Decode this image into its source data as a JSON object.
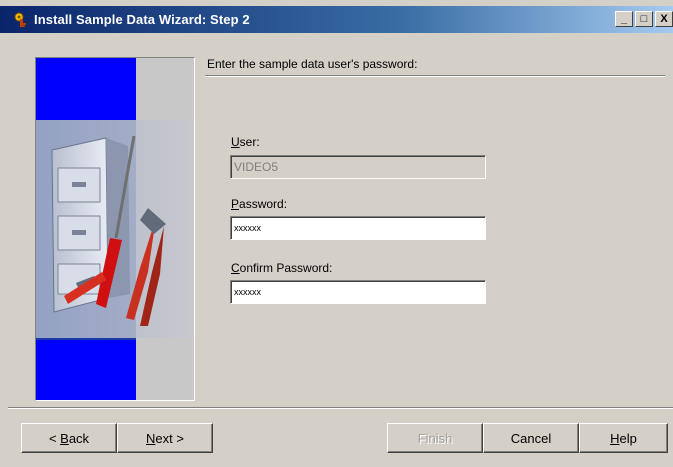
{
  "window": {
    "title": "Install Sample Data Wizard: Step 2",
    "minimize_glyph": "_",
    "maximize_glyph": "□",
    "close_glyph": "X"
  },
  "prompt": "Enter the sample data user's password:",
  "fields": {
    "user": {
      "label_ul": "U",
      "label_rest": "ser:",
      "value": "VIDEO5"
    },
    "password": {
      "label_ul": "P",
      "label_rest": "assword:",
      "value": "xxxxxx"
    },
    "confirm": {
      "label_ul": "C",
      "label_rest": "onfirm Password:",
      "value": "xxxxxx"
    }
  },
  "buttons": {
    "back": {
      "prefix": "< ",
      "ul": "B",
      "rest": "ack"
    },
    "next": {
      "ul": "N",
      "rest": "ext >"
    },
    "finish": "Finish",
    "cancel": "Cancel",
    "help": {
      "ul": "H",
      "rest": "elp"
    }
  },
  "colors": {
    "titlebar_start": "#0a246a",
    "titlebar_end": "#a6caf0",
    "panel_blue": "#0000ff",
    "dialog_bg": "#d4d0c8"
  }
}
